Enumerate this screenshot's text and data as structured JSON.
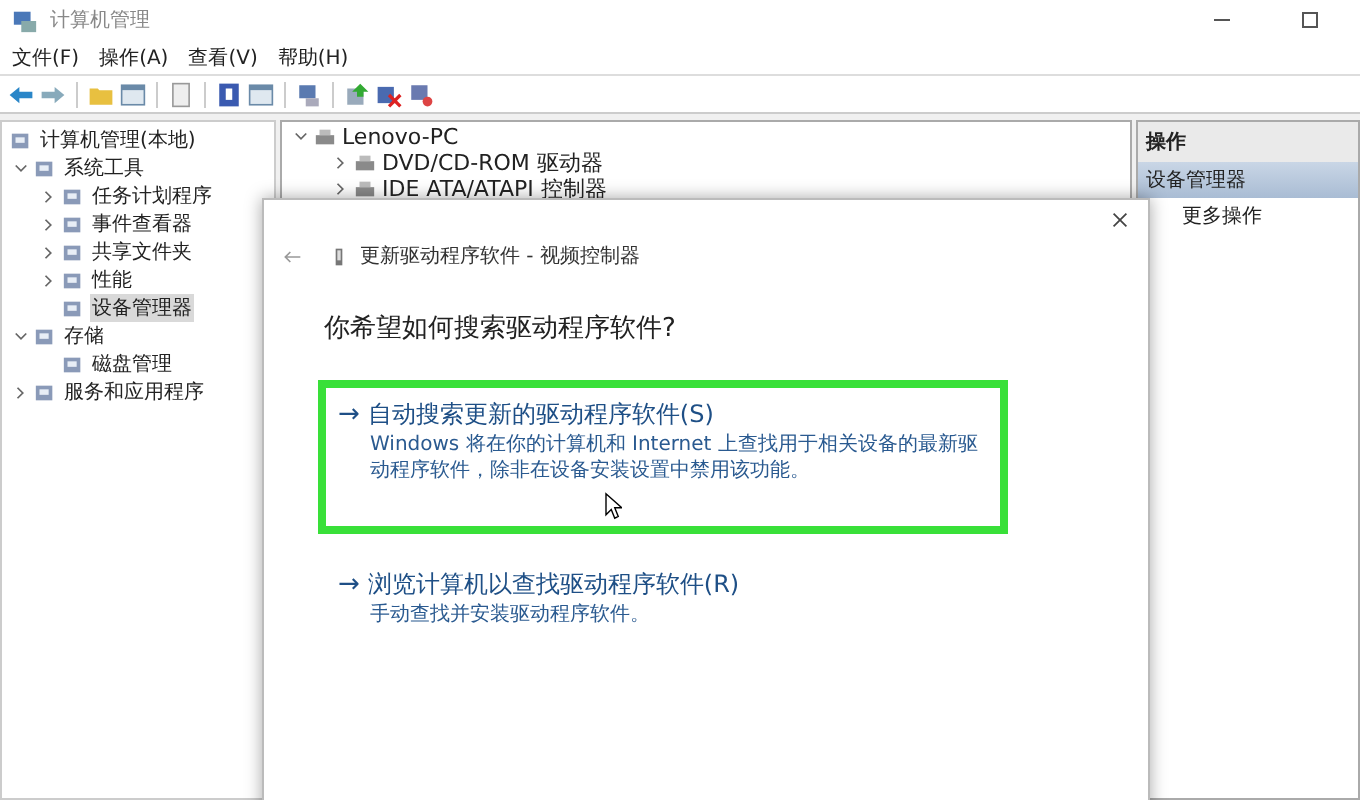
{
  "window": {
    "title": "计算机管理"
  },
  "menu": [
    "文件(F)",
    "操作(A)",
    "查看(V)",
    "帮助(H)"
  ],
  "tree": [
    {
      "label": "计算机管理(本地)",
      "selected": false,
      "children": [
        {
          "label": "系统工具",
          "expanded": true,
          "selected": false,
          "children": [
            {
              "label": "任务计划程序",
              "expanded": false,
              "selected": false
            },
            {
              "label": "事件查看器",
              "expanded": false,
              "selected": false
            },
            {
              "label": "共享文件夹",
              "expanded": false,
              "selected": false
            },
            {
              "label": "性能",
              "expanded": false,
              "selected": false
            },
            {
              "label": "设备管理器",
              "selected": true
            }
          ]
        },
        {
          "label": "存储",
          "expanded": true,
          "selected": false,
          "children": [
            {
              "label": "磁盘管理",
              "selected": false
            }
          ]
        },
        {
          "label": "服务和应用程序",
          "expanded": false,
          "selected": false
        }
      ]
    }
  ],
  "devices": [
    {
      "label": "Lenovo-PC",
      "expanded": true,
      "children": [
        {
          "label": "DVD/CD-ROM 驱动器",
          "expanded": false
        },
        {
          "label": "IDE ATA/ATAPI 控制器",
          "expanded": false
        }
      ]
    }
  ],
  "actions": {
    "header": "操作",
    "items": [
      {
        "label": "设备管理器",
        "selected": true
      },
      {
        "label": "更多操作",
        "selected": false
      }
    ]
  },
  "dialog": {
    "title": "更新驱动程序软件 - 视频控制器",
    "heading": "你希望如何搜索驱动程序软件?",
    "options": [
      {
        "arrow": "→",
        "title": "自动搜索更新的驱动程序软件(S)",
        "description": "Windows 将在你的计算机和 Internet 上查找用于相关设备的最新驱动程序软件，除非在设备安装设置中禁用该功能。",
        "highlighted": true
      },
      {
        "arrow": "→",
        "title": "浏览计算机以查找驱动程序软件(R)",
        "description": "手动查找并安装驱动程序软件。",
        "highlighted": false
      }
    ]
  }
}
